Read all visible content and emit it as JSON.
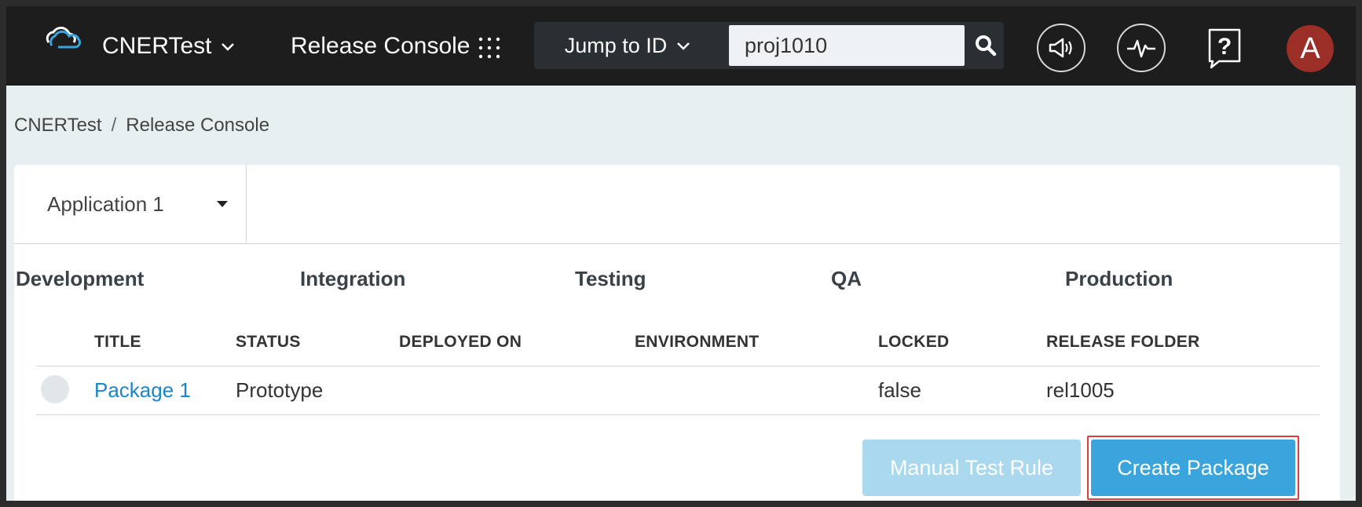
{
  "header": {
    "brand": "CNERTest",
    "console_title": "Release Console",
    "jump_label": "Jump to ID",
    "jump_value": "proj1010",
    "avatar_initial": "A"
  },
  "breadcrumb": {
    "items": [
      "CNERTest",
      "Release Console"
    ],
    "separator": "/"
  },
  "app_selector": {
    "selected": "Application 1"
  },
  "stages": [
    "Development",
    "Integration",
    "Testing",
    "QA",
    "Production"
  ],
  "table": {
    "columns": [
      "TITLE",
      "STATUS",
      "DEPLOYED ON",
      "ENVIRONMENT",
      "LOCKED",
      "RELEASE FOLDER"
    ],
    "rows": [
      {
        "title": "Package 1",
        "status": "Prototype",
        "deployed_on": "",
        "environment": "",
        "locked": "false",
        "release_folder": "rel1005"
      }
    ]
  },
  "actions": {
    "manual_test_rule": "Manual Test Rule",
    "create_package": "Create Package"
  },
  "colors": {
    "header_bg": "#1d1d1d",
    "accent": "#3aa5dc",
    "accent_disabled": "#a9d8ef",
    "link": "#1a86c5",
    "avatar": "#9b2e27",
    "highlight_border": "#e03c3c"
  },
  "icons": [
    "cloud-logo-icon",
    "chevron-down-icon",
    "app-grid-icon",
    "search-icon",
    "megaphone-icon",
    "activity-pulse-icon",
    "help-icon",
    "caret-down-icon"
  ]
}
